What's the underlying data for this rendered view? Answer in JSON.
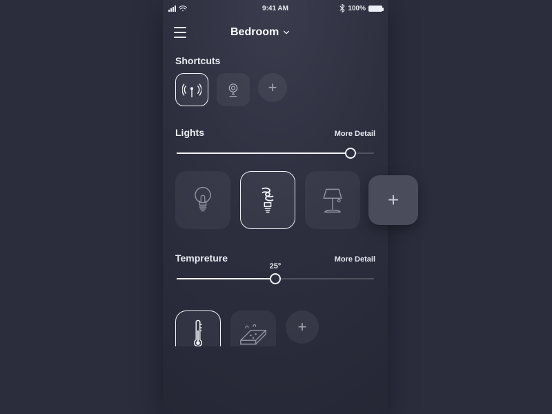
{
  "status": {
    "time": "9:41 AM",
    "battery_pct": "100%",
    "bluetooth_icon": "bluetooth-icon",
    "wifi_icon": "wifi-icon"
  },
  "header": {
    "room": "Bedroom"
  },
  "shortcuts": {
    "title": "Shortcuts",
    "items": [
      {
        "name": "antenna-icon",
        "selected": true
      },
      {
        "name": "camera-icon",
        "selected": false
      },
      {
        "name": "add-shortcut",
        "selected": false
      }
    ]
  },
  "lights": {
    "title": "Lights",
    "more": "More Detail",
    "slider_pct": 88,
    "items": [
      {
        "name": "bulb-icon",
        "selected": false
      },
      {
        "name": "cfl-bulb-icon",
        "selected": true
      },
      {
        "name": "lamp-icon",
        "selected": false
      },
      {
        "name": "add-light",
        "selected": false
      }
    ]
  },
  "temperature": {
    "title": "Tempreture",
    "more": "More Detail",
    "slider_pct": 50,
    "value_label": "25°",
    "items": [
      {
        "name": "thermometer-icon",
        "selected": true
      },
      {
        "name": "floor-heat-icon",
        "selected": false
      },
      {
        "name": "add-temperature",
        "selected": false
      }
    ]
  }
}
